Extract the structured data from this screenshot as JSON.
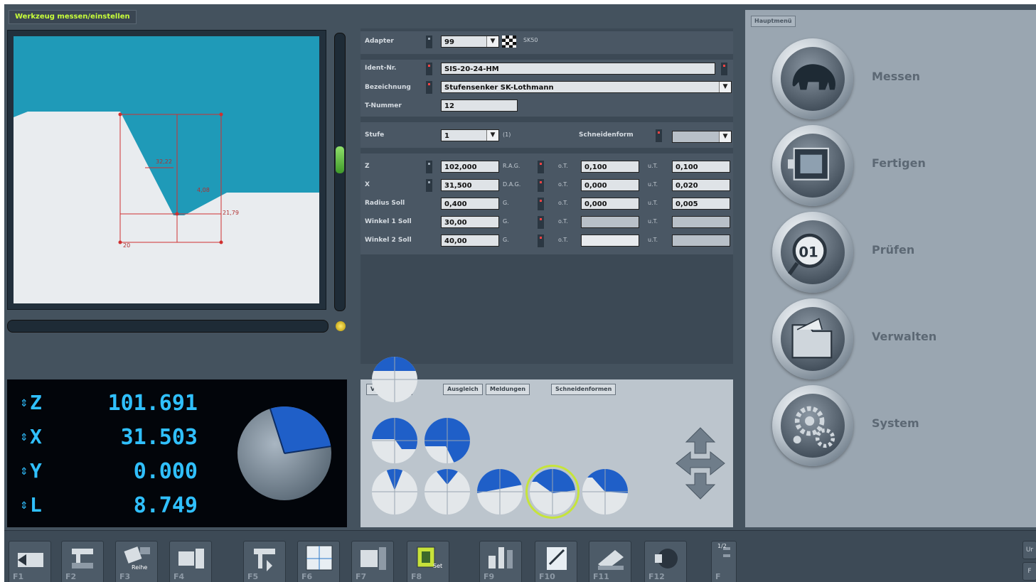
{
  "window": {
    "title": "Werkzeug messen/einstellen"
  },
  "preview": {
    "dims": [
      "32,22",
      "4,08",
      "21,79",
      "20"
    ]
  },
  "form": {
    "adapter": {
      "label": "Adapter",
      "value": "99",
      "code": "SK50"
    },
    "ident": {
      "label": "Ident-Nr.",
      "value": "SIS-20-24-HM"
    },
    "bezeichnung": {
      "label": "Bezeichnung",
      "value": "Stufensenker SK-Lothmann"
    },
    "anzahl": {
      "label": "T-Nummer",
      "value": "12"
    },
    "stufe": {
      "label": "Stufe",
      "value": "1",
      "count": "(1)"
    },
    "schneidenform": {
      "label": "Schneidenform",
      "value": ""
    },
    "rows": [
      {
        "label": "Z",
        "value": "102,000",
        "tag": "R.A.G.",
        "tol1_label": "o.T.",
        "tol1": "0,100",
        "tol2_label": "u.T.",
        "tol2": "0,100"
      },
      {
        "label": "X",
        "value": "31,500",
        "tag": "D.A.G.",
        "tol1_label": "o.T.",
        "tol1": "0,000",
        "tol2_label": "u.T.",
        "tol2": "0,020"
      },
      {
        "label": "Radius Soll",
        "value": "0,400",
        "tag": "G.",
        "tol1_label": "o.T.",
        "tol1": "0,000",
        "tol2_label": "u.T.",
        "tol2": "0,005"
      },
      {
        "label": "Winkel 1 Soll",
        "value": "30,00",
        "tag": "G.",
        "tol1_label": "o.T.",
        "tol1": "",
        "tol2_label": "u.T.",
        "tol2": ""
      },
      {
        "label": "Winkel 2 Soll",
        "value": "40,00",
        "tag": "G.",
        "tol1_label": "o.T.",
        "tol1": "",
        "tol2_label": "u.T.",
        "tol2": ""
      }
    ]
  },
  "dro": {
    "axes": [
      {
        "axis": "Z",
        "value": "101.691"
      },
      {
        "axis": "X",
        "value": "31.503"
      },
      {
        "axis": "Y",
        "value": "0.000"
      },
      {
        "axis": "L",
        "value": "8.749"
      }
    ]
  },
  "edge_panel": {
    "tabs": [
      "Volltastatur",
      "Ausgleich",
      "Meldungen",
      "Schneidenformen"
    ],
    "selected_shape": 8
  },
  "main_menu": {
    "tab": "Hauptmenü",
    "items": [
      {
        "label": "Messen",
        "icon": "elephant-icon"
      },
      {
        "label": "Fertigen",
        "icon": "machine-icon"
      },
      {
        "label": "Prüfen",
        "icon": "magnifier-icon"
      },
      {
        "label": "Verwalten",
        "icon": "folder-icon"
      },
      {
        "label": "System",
        "icon": "gears-icon"
      }
    ]
  },
  "fkeys": {
    "labels": [
      "F1",
      "F2",
      "F3",
      "F4",
      "F5",
      "F6",
      "F7",
      "F8",
      "F9",
      "F10",
      "F11",
      "F12",
      "F"
    ],
    "f3_caption": "Reihe",
    "f8_caption": "Set",
    "page_indicator": "1/2",
    "right_buttons": [
      "Ur",
      "F"
    ]
  },
  "colors": {
    "accent": "#30c0ff",
    "selection": "#c6e43a",
    "required": "#ff4444",
    "preview_tool": "#1f9ab8"
  }
}
